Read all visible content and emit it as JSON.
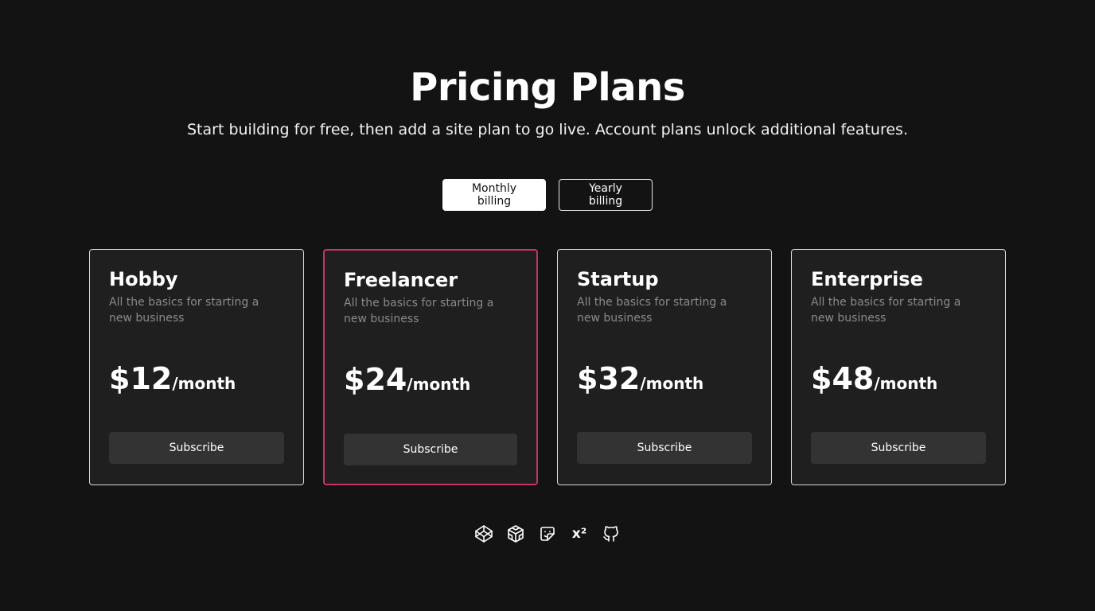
{
  "header": {
    "title": "Pricing Plans",
    "subtitle": "Start building for free, then add a site plan to go live. Account plans unlock additional features."
  },
  "billing": {
    "monthly_label": "Monthly billing",
    "yearly_label": "Yearly billing",
    "selected": "monthly"
  },
  "plans": [
    {
      "name": "Hobby",
      "description": "All the basics for starting a new business",
      "price": "$12",
      "period": "/month",
      "cta": "Subscribe",
      "featured": false
    },
    {
      "name": "Freelancer",
      "description": "All the basics for starting a new business",
      "price": "$24",
      "period": "/month",
      "cta": "Subscribe",
      "featured": true
    },
    {
      "name": "Startup",
      "description": "All the basics for starting a new business",
      "price": "$32",
      "period": "/month",
      "cta": "Subscribe",
      "featured": false
    },
    {
      "name": "Enterprise",
      "description": "All the basics for starting a new business",
      "price": "$48",
      "period": "/month",
      "cta": "Subscribe",
      "featured": false
    }
  ],
  "footer": {
    "icons": [
      "codepen-icon",
      "codesandbox-icon",
      "sticker-icon",
      "superscript-icon",
      "github-icon"
    ],
    "superscript_text": "x²"
  },
  "colors": {
    "background": "#131313",
    "card_background": "#1f1f1f",
    "featured_border": "#c8335f",
    "button_background": "#333333",
    "muted_text": "#8a8a8a"
  }
}
